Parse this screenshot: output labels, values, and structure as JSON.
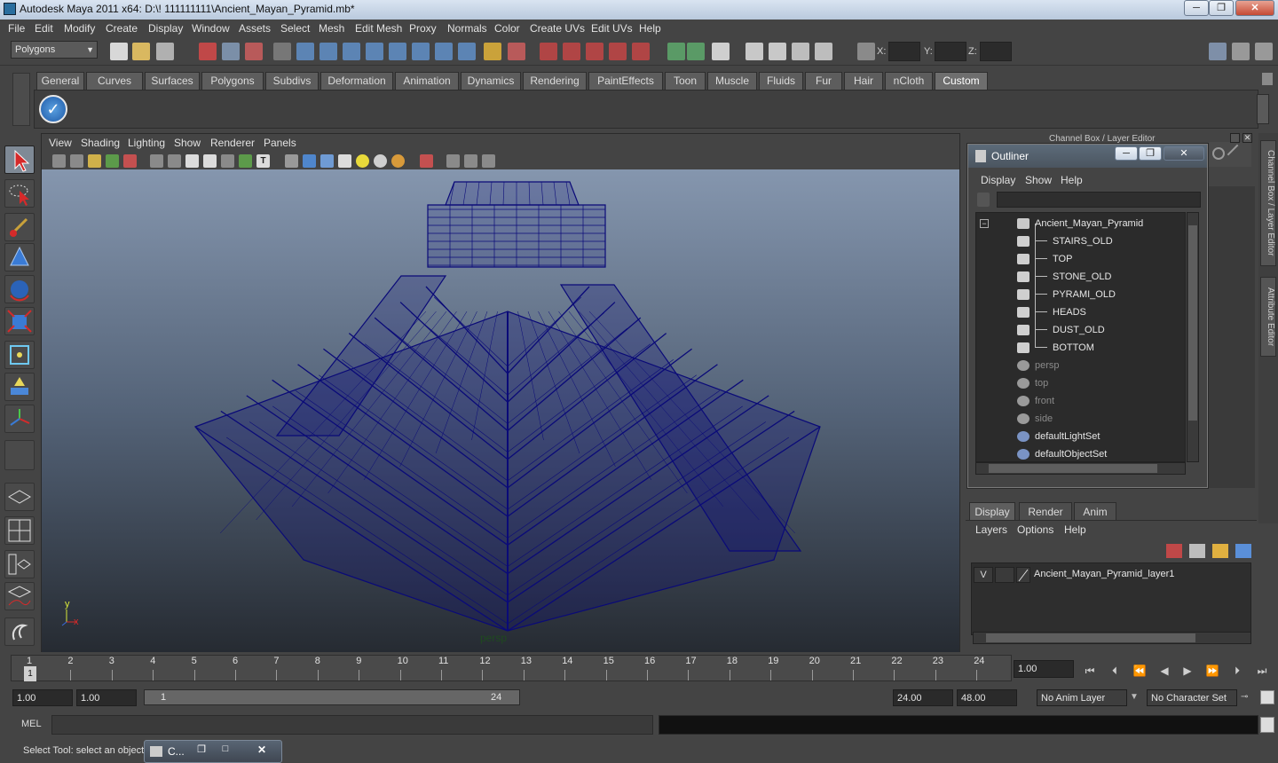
{
  "window": {
    "title": "Autodesk Maya 2011 x64: D:\\! 111111111\\Ancient_Mayan_Pyramid.mb*",
    "minimize": "─",
    "maximize": "❐",
    "close": "✕"
  },
  "menubar": [
    "File",
    "Edit",
    "Modify",
    "Create",
    "Display",
    "Window",
    "Assets",
    "Select",
    "Mesh",
    "Edit Mesh",
    "Proxy",
    "Normals",
    "Color",
    "Create UVs",
    "Edit UVs",
    "Help"
  ],
  "status_line": {
    "mode": "Polygons",
    "x_label": "X:",
    "y_label": "Y:",
    "z_label": "Z:"
  },
  "shelf": {
    "tabs": [
      "General",
      "Curves",
      "Surfaces",
      "Polygons",
      "Subdivs",
      "Deformation",
      "Animation",
      "Dynamics",
      "Rendering",
      "PaintEffects",
      "Toon",
      "Muscle",
      "Fluids",
      "Fur",
      "Hair",
      "nCloth",
      "Custom"
    ],
    "active_tab": "Custom"
  },
  "viewport": {
    "menus": [
      "View",
      "Shading",
      "Lighting",
      "Show",
      "Renderer",
      "Panels"
    ],
    "camera_label": "persp",
    "axis_x": "x",
    "axis_y": "y",
    "wire_color": "#0a0a78"
  },
  "right_panel": {
    "header": "Channel Box / Layer Editor",
    "side_tabs": [
      "Channel Box / Layer Editor",
      "Attribute Editor"
    ]
  },
  "outliner": {
    "title": "Outliner",
    "menus": [
      "Display",
      "Show",
      "Help"
    ],
    "items": [
      {
        "label": "Ancient_Mayan_Pyramid",
        "indent": 0,
        "dim": false,
        "type": "group",
        "expanded": true
      },
      {
        "label": "STAIRS_OLD",
        "indent": 1,
        "dim": false,
        "type": "mesh"
      },
      {
        "label": "TOP",
        "indent": 1,
        "dim": false,
        "type": "mesh"
      },
      {
        "label": "STONE_OLD",
        "indent": 1,
        "dim": false,
        "type": "mesh"
      },
      {
        "label": "PYRAMI_OLD",
        "indent": 1,
        "dim": false,
        "type": "mesh"
      },
      {
        "label": "HEADS",
        "indent": 1,
        "dim": false,
        "type": "mesh"
      },
      {
        "label": "DUST_OLD",
        "indent": 1,
        "dim": false,
        "type": "mesh"
      },
      {
        "label": "BOTTOM",
        "indent": 1,
        "dim": false,
        "type": "mesh"
      },
      {
        "label": "persp",
        "indent": 0,
        "dim": true,
        "type": "camera"
      },
      {
        "label": "top",
        "indent": 0,
        "dim": true,
        "type": "camera"
      },
      {
        "label": "front",
        "indent": 0,
        "dim": true,
        "type": "camera"
      },
      {
        "label": "side",
        "indent": 0,
        "dim": true,
        "type": "camera"
      },
      {
        "label": "defaultLightSet",
        "indent": 0,
        "dim": false,
        "type": "set"
      },
      {
        "label": "defaultObjectSet",
        "indent": 0,
        "dim": false,
        "type": "set"
      }
    ]
  },
  "layer_editor": {
    "tabs": [
      "Display",
      "Render",
      "Anim"
    ],
    "active_tab": "Display",
    "menus": [
      "Layers",
      "Options",
      "Help"
    ],
    "layers": [
      {
        "visible": "V",
        "name": "Ancient_Mayan_Pyramid_layer1"
      }
    ]
  },
  "timeline": {
    "ticks": [
      "1",
      "2",
      "3",
      "4",
      "5",
      "6",
      "7",
      "8",
      "9",
      "10",
      "11",
      "12",
      "13",
      "14",
      "15",
      "16",
      "17",
      "18",
      "19",
      "20",
      "21",
      "22",
      "23",
      "24"
    ],
    "current_frame": "1",
    "current_time": "1.00"
  },
  "range": {
    "start_time": "1.00",
    "playback_start": "1.00",
    "range_start_label": "1",
    "range_end_label": "24",
    "playback_end": "24.00",
    "end_time": "48.00",
    "anim_layer": "No Anim Layer",
    "character_set": "No Character Set"
  },
  "command_line": {
    "label": "MEL"
  },
  "help_line": {
    "text": "Select Tool: select an object",
    "task_label": "C..."
  }
}
